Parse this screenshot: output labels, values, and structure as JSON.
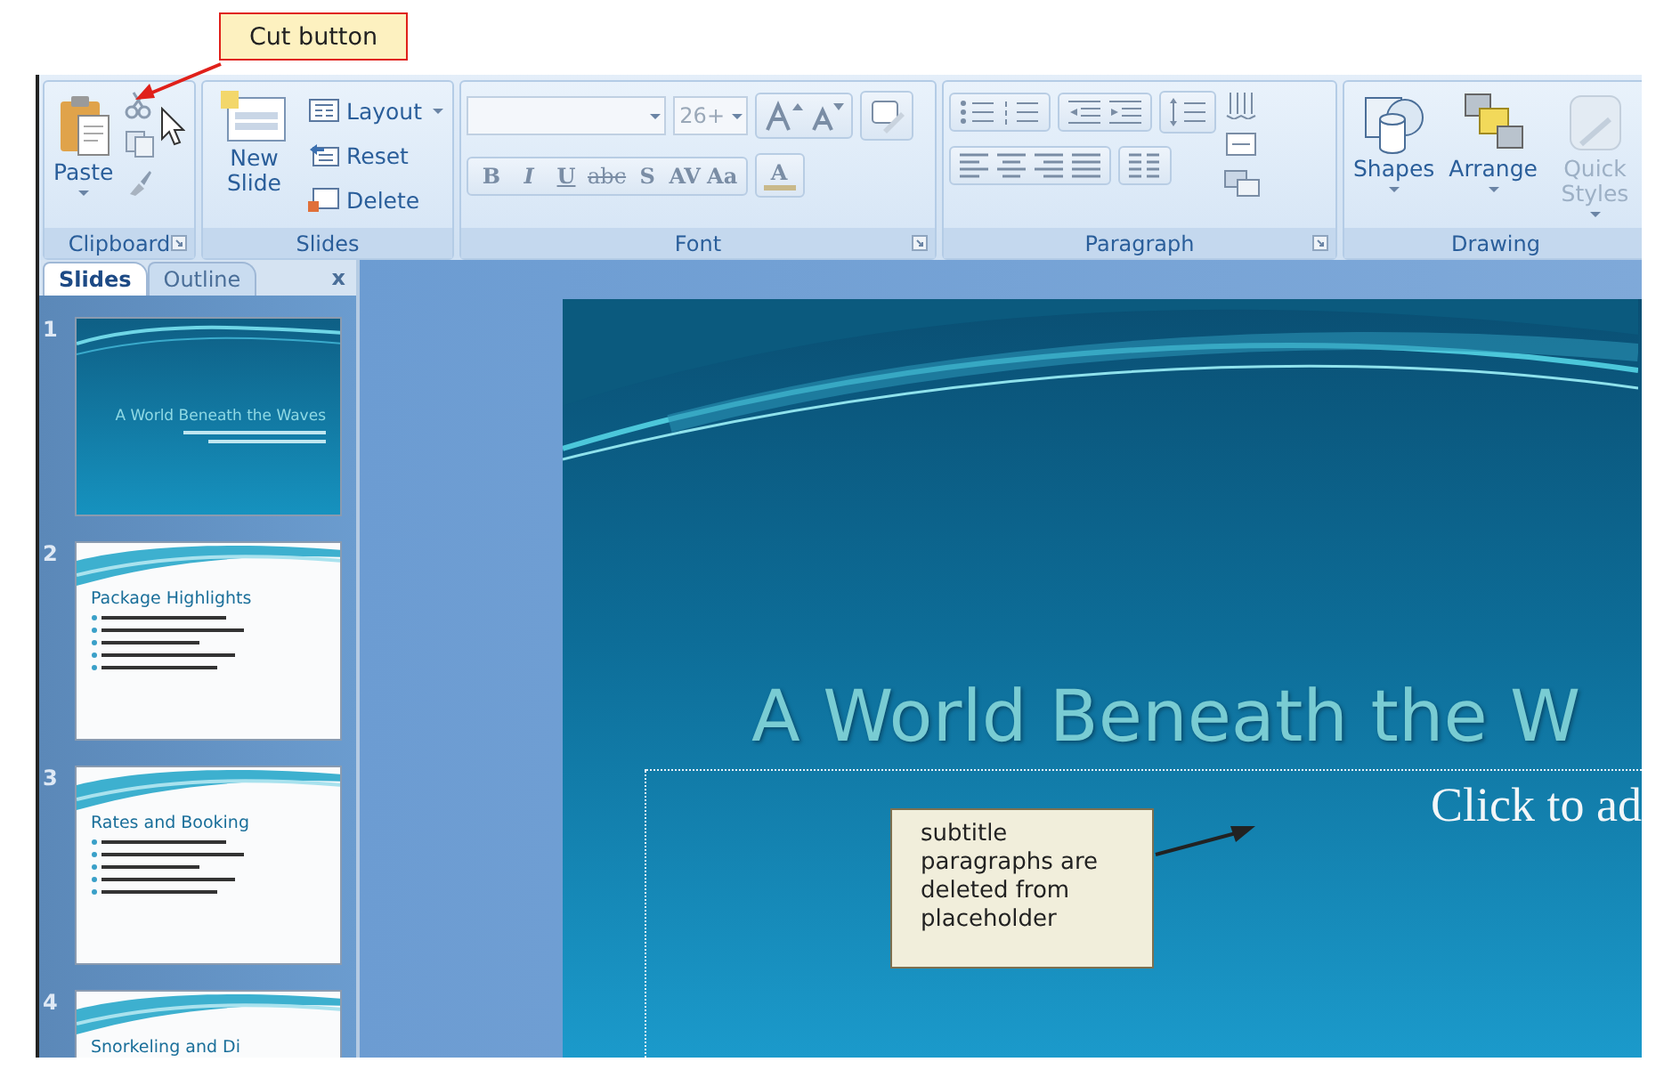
{
  "callouts": [
    {
      "kind": "tag",
      "text": "Cut button"
    },
    {
      "kind": "note",
      "text": "subtitle paragraphs are deleted from placeholder"
    }
  ],
  "ribbon": {
    "groups": [
      {
        "label": "Clipboard",
        "launcher": true,
        "kind": "clipboard",
        "big": "Paste"
      },
      {
        "label": "Slides",
        "launcher": false,
        "kind": "slides",
        "big": "New Slide",
        "small": [
          "Layout",
          "Reset",
          "Delete"
        ]
      },
      {
        "label": "Font",
        "launcher": true,
        "kind": "font",
        "size": "26+",
        "format": [
          "B",
          "I",
          "U",
          "abc",
          "S",
          "AV",
          "Aa",
          "A"
        ]
      },
      {
        "label": "Paragraph",
        "launcher": true,
        "kind": "paragraph"
      },
      {
        "label": "Drawing",
        "launcher": false,
        "kind": "drawing",
        "buttons": [
          {
            "label": "Shapes",
            "disabled": false
          },
          {
            "label": "Arrange",
            "disabled": false
          },
          {
            "label": "Quick Styles",
            "disabled": true
          }
        ]
      }
    ]
  },
  "pane": {
    "tabs": [
      {
        "label": "Slides",
        "selected": true
      },
      {
        "label": "Outline",
        "selected": false
      }
    ],
    "close": "x",
    "thumbnails": [
      {
        "number": "1",
        "kind": "title",
        "title": "A World Beneath the Waves"
      },
      {
        "number": "2",
        "kind": "content",
        "title": "Package Highlights"
      },
      {
        "number": "3",
        "kind": "content",
        "title": "Rates and Booking"
      },
      {
        "number": "4",
        "kind": "heading",
        "title": "Snorkeling and Di"
      }
    ]
  },
  "slide": {
    "title": "A World Beneath the W",
    "subtitle_placeholder": "Click to ad"
  }
}
